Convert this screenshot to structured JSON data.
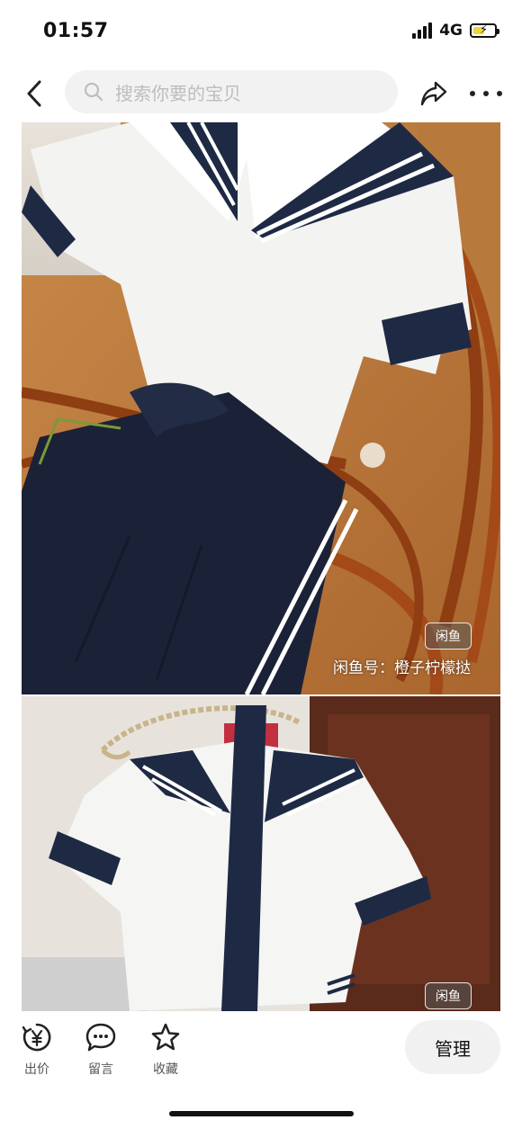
{
  "status_bar": {
    "time": "01:57",
    "network": "4G",
    "battery_level": 0.55
  },
  "nav": {
    "search_placeholder": "搜索你要的宝贝"
  },
  "photos": [
    {
      "watermark_logo": "闲鱼",
      "watermark_text": "闲鱼号：橙子柠檬挞"
    },
    {
      "watermark_logo": "闲鱼"
    }
  ],
  "bottom_bar": {
    "actions": [
      {
        "label": "出价",
        "icon": "yen-coin-icon"
      },
      {
        "label": "留言",
        "icon": "chat-bubble-icon"
      },
      {
        "label": "收藏",
        "icon": "star-icon"
      }
    ],
    "manage_label": "管理"
  }
}
